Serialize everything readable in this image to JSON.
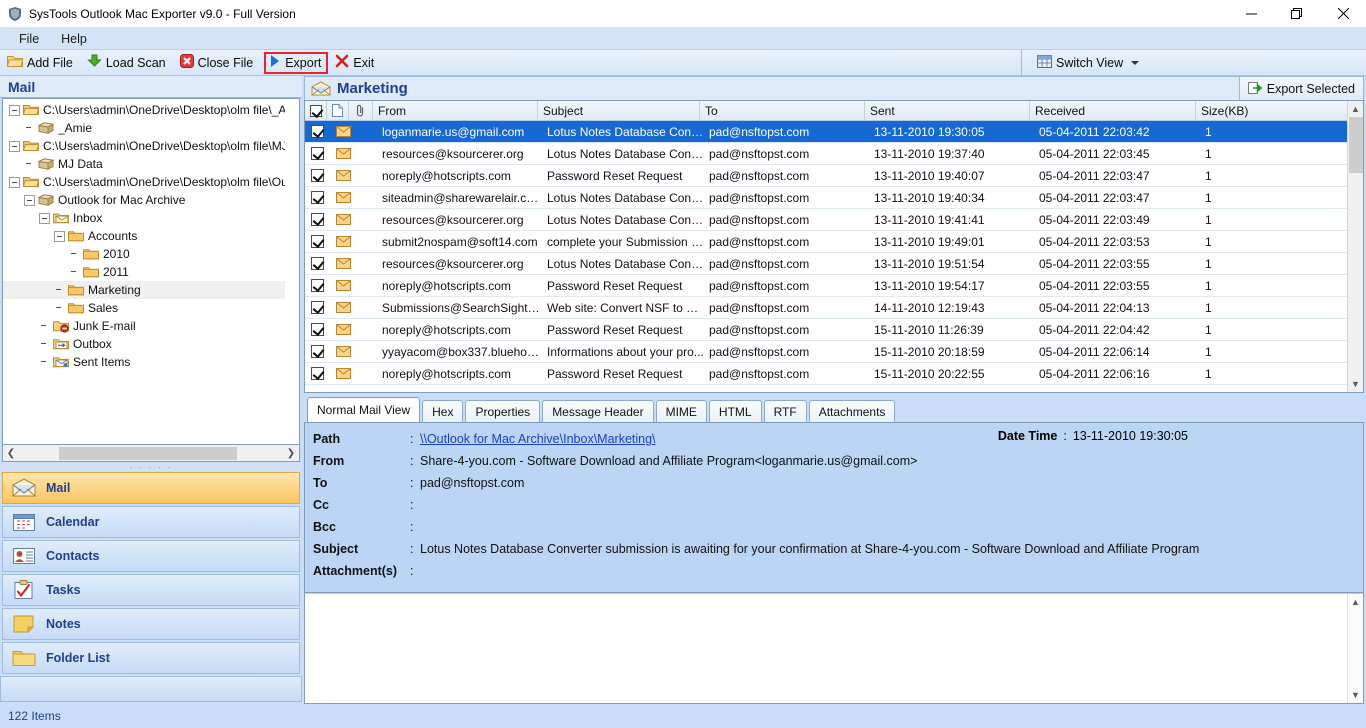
{
  "window": {
    "title": "SysTools Outlook Mac Exporter v9.0 - Full Version",
    "app_icon": "shield-icon",
    "minimize": "–",
    "maximize": "❐",
    "close": "✕"
  },
  "menubar": {
    "items": [
      "File",
      "Help"
    ]
  },
  "toolbar": {
    "buttons": [
      {
        "label": "Add File",
        "icon": "open-folder-icon"
      },
      {
        "label": "Load Scan",
        "icon": "download-arrow-icon"
      },
      {
        "label": "Close File",
        "icon": "red-x-circle-icon"
      },
      {
        "label": "Export",
        "icon": "blue-play-icon",
        "highlighted": true
      },
      {
        "label": "Exit",
        "icon": "red-x-icon"
      }
    ],
    "switch_view": {
      "label": "Switch View",
      "icon": "grid-icon"
    }
  },
  "sidebar": {
    "header": "Mail",
    "tree": [
      {
        "label": "C:\\Users\\admin\\OneDrive\\Desktop\\olm file\\_Ami",
        "indent": 0,
        "twisty": "minus",
        "icon": "open-folder-icon"
      },
      {
        "label": "_Amie",
        "indent": 1,
        "twisty": "none",
        "icon": "archive-icon"
      },
      {
        "label": "C:\\Users\\admin\\OneDrive\\Desktop\\olm file\\MJ",
        "indent": 0,
        "twisty": "minus",
        "icon": "open-folder-icon"
      },
      {
        "label": "MJ Data",
        "indent": 1,
        "twisty": "none",
        "icon": "archive-icon"
      },
      {
        "label": "C:\\Users\\admin\\OneDrive\\Desktop\\olm file\\Out",
        "indent": 0,
        "twisty": "minus",
        "icon": "open-folder-icon"
      },
      {
        "label": "Outlook for Mac Archive",
        "indent": 1,
        "twisty": "minus",
        "icon": "archive-icon"
      },
      {
        "label": "Inbox",
        "indent": 2,
        "twisty": "minus",
        "icon": "inbox-icon"
      },
      {
        "label": "Accounts",
        "indent": 3,
        "twisty": "minus",
        "icon": "folder-icon"
      },
      {
        "label": "2010",
        "indent": 4,
        "twisty": "none",
        "icon": "folder-icon"
      },
      {
        "label": "2011",
        "indent": 4,
        "twisty": "none",
        "icon": "folder-icon"
      },
      {
        "label": "Marketing",
        "indent": 3,
        "twisty": "none",
        "icon": "folder-icon",
        "selected": true
      },
      {
        "label": "Sales",
        "indent": 3,
        "twisty": "none",
        "icon": "folder-icon"
      },
      {
        "label": "Junk E-mail",
        "indent": 2,
        "twisty": "none",
        "icon": "junk-folder-icon"
      },
      {
        "label": "Outbox",
        "indent": 2,
        "twisty": "none",
        "icon": "outbox-icon"
      },
      {
        "label": "Sent Items",
        "indent": 2,
        "twisty": "none",
        "icon": "sent-items-icon"
      }
    ],
    "nav_items": [
      {
        "label": "Mail",
        "icon": "mail-envelope-icon",
        "active": true
      },
      {
        "label": "Calendar",
        "icon": "calendar-icon",
        "active": false
      },
      {
        "label": "Contacts",
        "icon": "contacts-icon",
        "active": false
      },
      {
        "label": "Tasks",
        "icon": "tasks-clipboard-icon",
        "active": false
      },
      {
        "label": "Notes",
        "icon": "notes-icon",
        "active": false
      },
      {
        "label": "Folder List",
        "icon": "folder-icon",
        "active": false
      }
    ]
  },
  "main": {
    "folder_title": "Marketing",
    "folder_icon": "mail-envelope-icon",
    "export_selected": {
      "label": "Export Selected",
      "icon": "export-arrow-icon"
    },
    "columns": [
      "",
      "",
      "",
      "From",
      "Subject",
      "To",
      "Sent",
      "Received",
      "Size(KB)"
    ],
    "column_headers": {
      "from": "From",
      "subject": "Subject",
      "to": "To",
      "sent": "Sent",
      "received": "Received",
      "size": "Size(KB)"
    },
    "rows": [
      {
        "checked": true,
        "from": "loganmarie.us@gmail.com",
        "subject": "Lotus Notes Database Conve...",
        "to": "pad@nsftopst.com",
        "sent": "13-11-2010 19:30:05",
        "received": "05-04-2011 22:03:42",
        "size": "1",
        "selected": true
      },
      {
        "checked": true,
        "from": "resources@ksourcerer.org",
        "subject": "Lotus Notes Database Conve...",
        "to": "pad@nsftopst.com",
        "sent": "13-11-2010 19:37:40",
        "received": "05-04-2011 22:03:45",
        "size": "1",
        "selected": false
      },
      {
        "checked": true,
        "from": "noreply@hotscripts.com",
        "subject": "Password Reset Request",
        "to": "pad@nsftopst.com",
        "sent": "13-11-2010 19:40:07",
        "received": "05-04-2011 22:03:47",
        "size": "1",
        "selected": false
      },
      {
        "checked": true,
        "from": "siteadmin@sharewarelair.com",
        "subject": "Lotus Notes Database Conve...",
        "to": "pad@nsftopst.com",
        "sent": "13-11-2010 19:40:34",
        "received": "05-04-2011 22:03:47",
        "size": "1",
        "selected": false
      },
      {
        "checked": true,
        "from": "resources@ksourcerer.org",
        "subject": "Lotus Notes Database Conve...",
        "to": "pad@nsftopst.com",
        "sent": "13-11-2010 19:41:41",
        "received": "05-04-2011 22:03:49",
        "size": "1",
        "selected": false
      },
      {
        "checked": true,
        "from": "submit2nospam@soft14.com",
        "subject": "complete your Submission t...",
        "to": "pad@nsftopst.com",
        "sent": "13-11-2010 19:49:01",
        "received": "05-04-2011 22:03:53",
        "size": "1",
        "selected": false
      },
      {
        "checked": true,
        "from": "resources@ksourcerer.org",
        "subject": "Lotus Notes Database Conve...",
        "to": "pad@nsftopst.com",
        "sent": "13-11-2010 19:51:54",
        "received": "05-04-2011 22:03:55",
        "size": "1",
        "selected": false
      },
      {
        "checked": true,
        "from": "noreply@hotscripts.com",
        "subject": "Password Reset Request",
        "to": "pad@nsftopst.com",
        "sent": "13-11-2010 19:54:17",
        "received": "05-04-2011 22:03:55",
        "size": "1",
        "selected": false
      },
      {
        "checked": true,
        "from": "Submissions@SearchSight.c...",
        "subject": "Web site: Convert NSF to PS...",
        "to": "pad@nsftopst.com",
        "sent": "14-11-2010 12:19:43",
        "received": "05-04-2011 22:04:13",
        "size": "1",
        "selected": false
      },
      {
        "checked": true,
        "from": "noreply@hotscripts.com",
        "subject": "Password Reset Request",
        "to": "pad@nsftopst.com",
        "sent": "15-11-2010 11:26:39",
        "received": "05-04-2011 22:04:42",
        "size": "1",
        "selected": false
      },
      {
        "checked": true,
        "from": "yyayacom@box337.bluehost....",
        "subject": "Informations about your pro...",
        "to": "pad@nsftopst.com",
        "sent": "15-11-2010 20:18:59",
        "received": "05-04-2011 22:06:14",
        "size": "1",
        "selected": false
      },
      {
        "checked": true,
        "from": "noreply@hotscripts.com",
        "subject": "Password Reset Request",
        "to": "pad@nsftopst.com",
        "sent": "15-11-2010 20:22:55",
        "received": "05-04-2011 22:06:16",
        "size": "1",
        "selected": false
      }
    ]
  },
  "detail": {
    "tabs": [
      {
        "label": "Normal Mail View",
        "active": true
      },
      {
        "label": "Hex",
        "active": false
      },
      {
        "label": "Properties",
        "active": false
      },
      {
        "label": "Message Header",
        "active": false
      },
      {
        "label": "MIME",
        "active": false
      },
      {
        "label": "HTML",
        "active": false
      },
      {
        "label": "RTF",
        "active": false
      },
      {
        "label": "Attachments",
        "active": false
      }
    ],
    "fields": [
      {
        "label": "Path",
        "value": "\\\\Outlook for Mac Archive\\Inbox\\Marketing\\",
        "is_link": true
      },
      {
        "label": "From",
        "value": "Share-4-you.com - Software Download and Affiliate Program<loganmarie.us@gmail.com>",
        "is_link": false
      },
      {
        "label": "To",
        "value": "pad@nsftopst.com",
        "is_link": false
      },
      {
        "label": "Cc",
        "value": "",
        "is_link": false
      },
      {
        "label": "Bcc",
        "value": "",
        "is_link": false
      },
      {
        "label": "Subject",
        "value": "Lotus Notes Database Converter submission is awaiting for your confirmation at Share-4-you.com - Software Download and Affiliate Program",
        "is_link": false
      },
      {
        "label": "Attachment(s)",
        "value": "",
        "is_link": false
      }
    ],
    "datetime_label": "Date Time",
    "datetime_value": "13-11-2010 19:30:05"
  },
  "statusbar": {
    "text": "122 Items"
  },
  "colors": {
    "accent_blue": "#1f3f8f",
    "selection_blue": "#1669d3",
    "panel_blue": "#c9ddf7",
    "header_blue": "#bcd5f5",
    "highlight_red": "#e8262a",
    "nav_active_gold": "#fbc55e"
  }
}
